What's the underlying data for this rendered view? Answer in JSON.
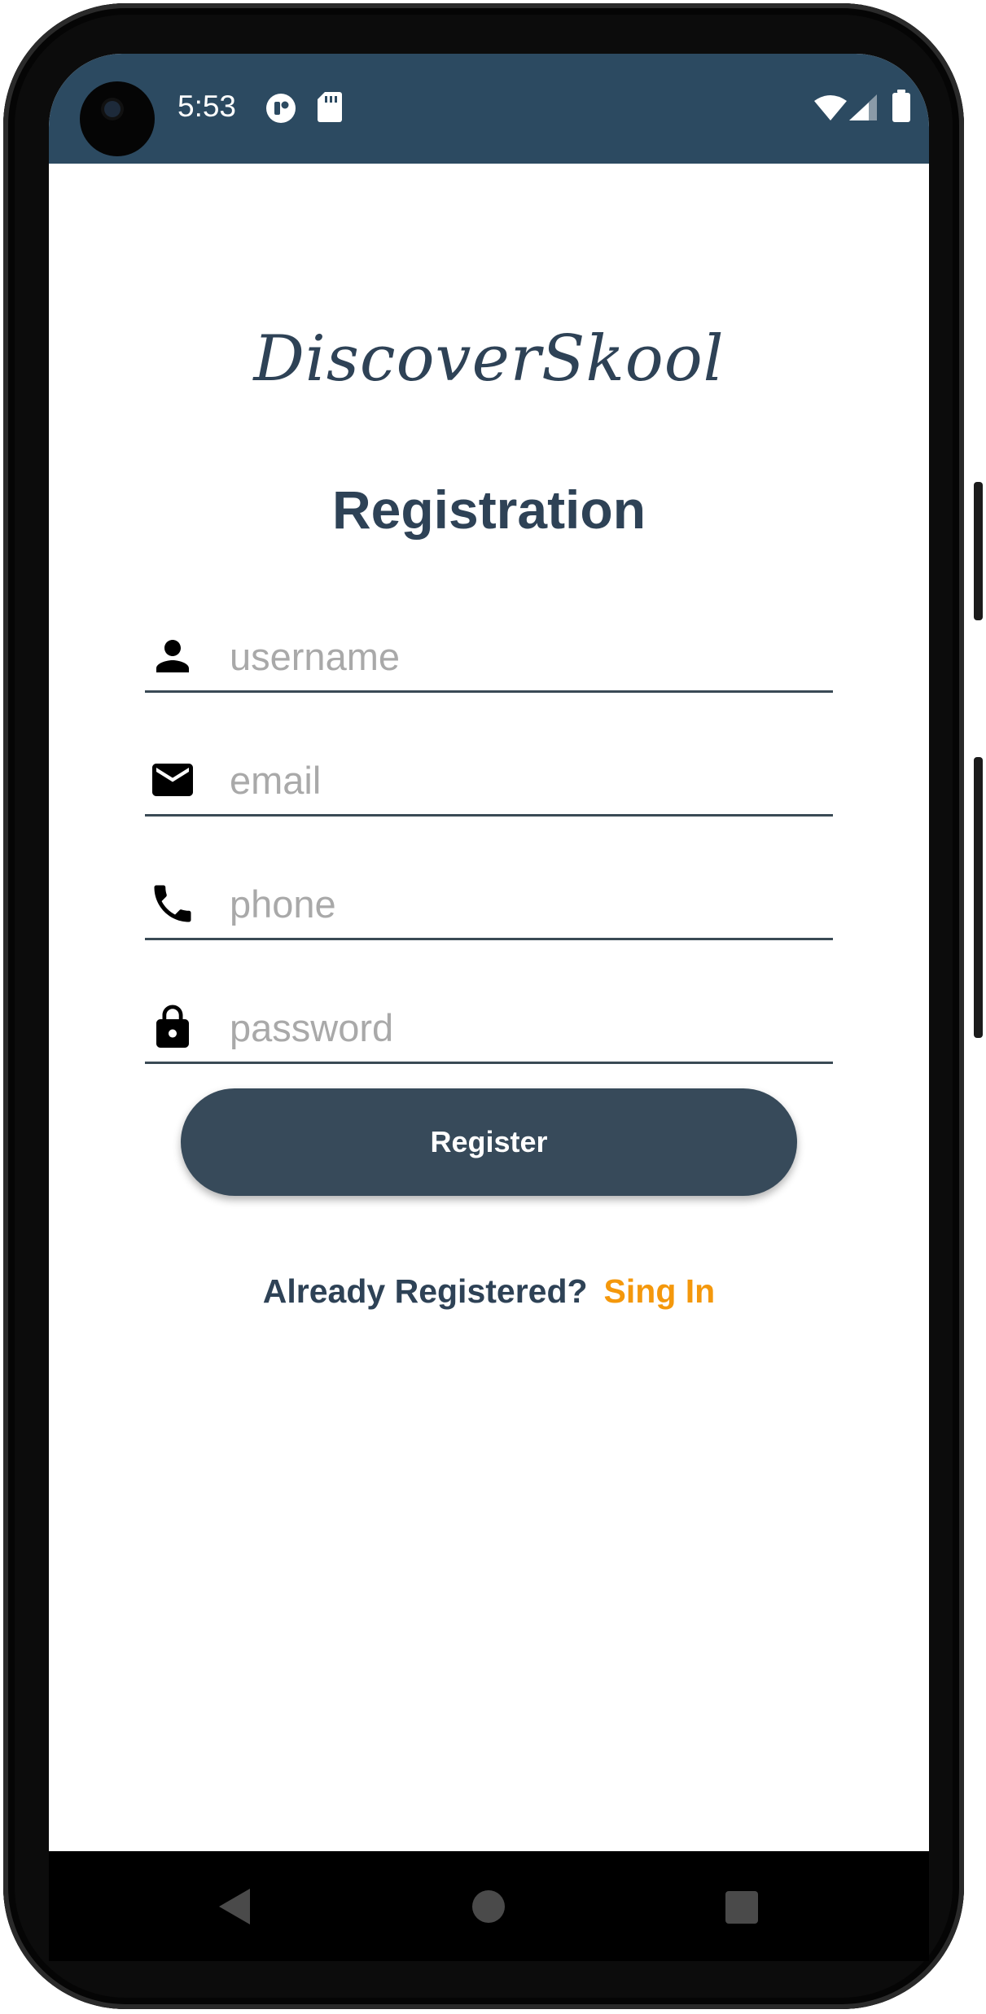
{
  "status_bar": {
    "time": "5:53",
    "icons": [
      "app-notification-icon",
      "sd-card-icon",
      "wifi-icon",
      "cellular-signal-icon",
      "battery-icon"
    ]
  },
  "app": {
    "title": "DiscoverSkool"
  },
  "form": {
    "title": "Registration",
    "fields": {
      "username": {
        "placeholder": "username",
        "value": "",
        "icon": "person-icon"
      },
      "email": {
        "placeholder": "email",
        "value": "",
        "icon": "mail-icon"
      },
      "phone": {
        "placeholder": "phone",
        "value": "",
        "icon": "phone-icon"
      },
      "password": {
        "placeholder": "password",
        "value": "",
        "icon": "lock-icon"
      }
    },
    "register_label": "Register",
    "already_text": "Already Registered?",
    "signin_label": "Sing In"
  },
  "nav_bar": {
    "icons": [
      "back-icon",
      "home-icon",
      "recents-icon"
    ]
  },
  "colors": {
    "status_bar": "#2c4a61",
    "primary_text": "#2e4256",
    "button": "#374a5a",
    "link": "#f4980c"
  }
}
